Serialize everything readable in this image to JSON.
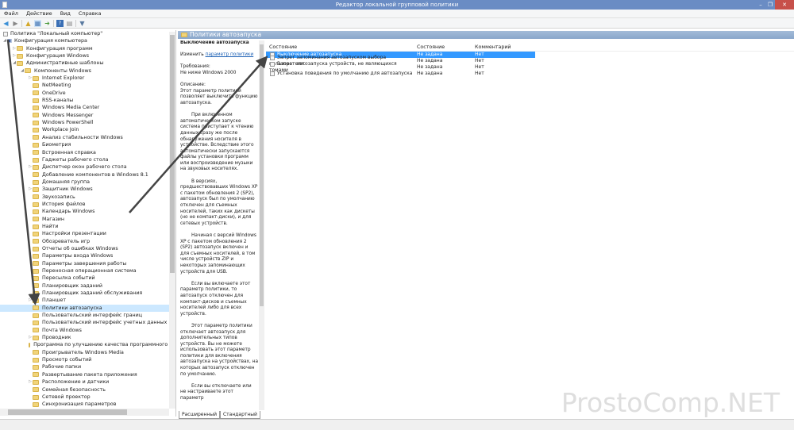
{
  "window": {
    "title": "Редактор локальной групповой политики",
    "minimize": "–",
    "restore": "❐",
    "close": "✕"
  },
  "menu": [
    "Файл",
    "Действие",
    "Вид",
    "Справка"
  ],
  "tree": {
    "root": "Политика \"Локальный компьютер\"",
    "computer_config": "Конфигурация компьютера",
    "level1": [
      "Конфигурация программ",
      "Конфигурация Windows",
      "Административные шаблоны"
    ],
    "components": "Компоненты Windows",
    "items": [
      "Internet Explorer",
      "NetMeeting",
      "OneDrive",
      "RSS-каналы",
      "Windows Media Center",
      "Windows Messenger",
      "Windows PowerShell",
      "Workplace Join",
      "Анализ стабильности Windows",
      "Биометрия",
      "Встроенная справка",
      "Гаджеты рабочего стола",
      "Диспетчер окон рабочего стола",
      "Добавление компонентов в Windows 8.1",
      "Домашняя группа",
      "Защитник Windows",
      "Звукозапись",
      "История файлов",
      "Календарь Windows",
      "Магазин",
      "Найти",
      "Настройки презентации",
      "Обозреватель игр",
      "Отчеты об ошибках Windows",
      "Параметры входа Windows",
      "Параметры завершения работы",
      "Переносная операционная система",
      "Пересылка событий",
      "Планировщик заданий",
      "Планировщик заданий обслуживания",
      "Планшет",
      "Политики автозапуска",
      "Пользовательский интерфейс границ",
      "Пользовательский интерфейс учетных данных",
      "Почта Windows",
      "Проводник",
      "Программа по улучшению качества программного об",
      "Проигрыватель Windows Media",
      "Просмотр событий",
      "Рабочие папки",
      "Развертывание пакета приложения",
      "Расположение и датчики",
      "Семейная безопасность",
      "Сетевой проектор",
      "Синхронизация параметров"
    ],
    "expandable": [
      0,
      12,
      15,
      30,
      35,
      41
    ],
    "selected": 31
  },
  "header": {
    "title": "Политики автозапуска"
  },
  "description": {
    "title": "Выключение автозапуска",
    "edit_prefix": "Изменить",
    "edit_link": "параметр политики",
    "req_label": "Требования:",
    "req_value": "Не ниже Windows 2000",
    "desc_label": "Описание:",
    "paragraphs": [
      "Этот параметр политики позволяет выключить функцию автозапуска.",
      "При включенном автоматическом запуске система приступает к чтению данных сразу же после обнаружения носителя в устройстве. Вследствие этого автоматически запускаются файлы установки программ или воспроизведение музыки на звуковых носителях.",
      "В версиях, предшествовавших Windows XP с пакетом обновления 2 (SP2), автозапуск был по умолчанию отключен для съемных носителей, таких как дискеты (но не компакт-диски), и для сетевых устройств.",
      "Начиная с версий Windows XP с пакетом обновления 2 (SP2) автозапуск включен и для съемных носителей, в том числе устройств ZIP и некоторых запоминающих устройств для USB.",
      "Если вы включаете этот параметр политики, то автозапуск отключен для компакт-дисков и съемных носителей либо для всех устройств.",
      "Этот параметр политики отключает автозапуск для дополнительных типов устройств. Вы не можете использовать этот параметр политики для включения автозапуска на устройствах, на которых автозапуск отключен по умолчанию.",
      "Если вы отключаете или не настраиваете этот параметр"
    ]
  },
  "tabs": [
    "Расширенный",
    "Стандартный"
  ],
  "list": {
    "columns": [
      "Состояние",
      "Состояние",
      "Комментарий"
    ],
    "rows": [
      {
        "name": "Выключение автозапуска",
        "state": "Не задана",
        "comment": "Нет"
      },
      {
        "name": "Запрет запоминания автозапуском выбора пользователя.",
        "state": "Не задана",
        "comment": "Нет"
      },
      {
        "name": "Запрет автозапуска устройств, не являющихся томами",
        "state": "Не задана",
        "comment": "Нет"
      },
      {
        "name": "Установка поведения по умолчанию для автозапуска",
        "state": "Не задана",
        "comment": "Нет"
      }
    ]
  },
  "watermark": "ProstoComp.NET"
}
